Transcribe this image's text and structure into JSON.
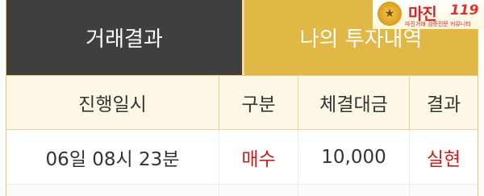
{
  "tabs": [
    {
      "label": "거래결과",
      "active": true
    },
    {
      "label": "나의 투자내역",
      "active": false
    }
  ],
  "table": {
    "columns": [
      "진행일시",
      "구분",
      "체결대금",
      "결과"
    ],
    "rows": [
      {
        "time": "06일 08시 23분",
        "type": "매수",
        "amount": "10,000",
        "result": "실현"
      }
    ]
  },
  "logo": {
    "name": "마진",
    "number": "119",
    "tagline": "마진거래 검증전문 커뮤니티"
  },
  "colors": {
    "active_tab": "#3f3f3f",
    "inactive_tab": "#e1b846",
    "header_bg": "#fef8e7",
    "accent_red": "#c81e1e"
  }
}
